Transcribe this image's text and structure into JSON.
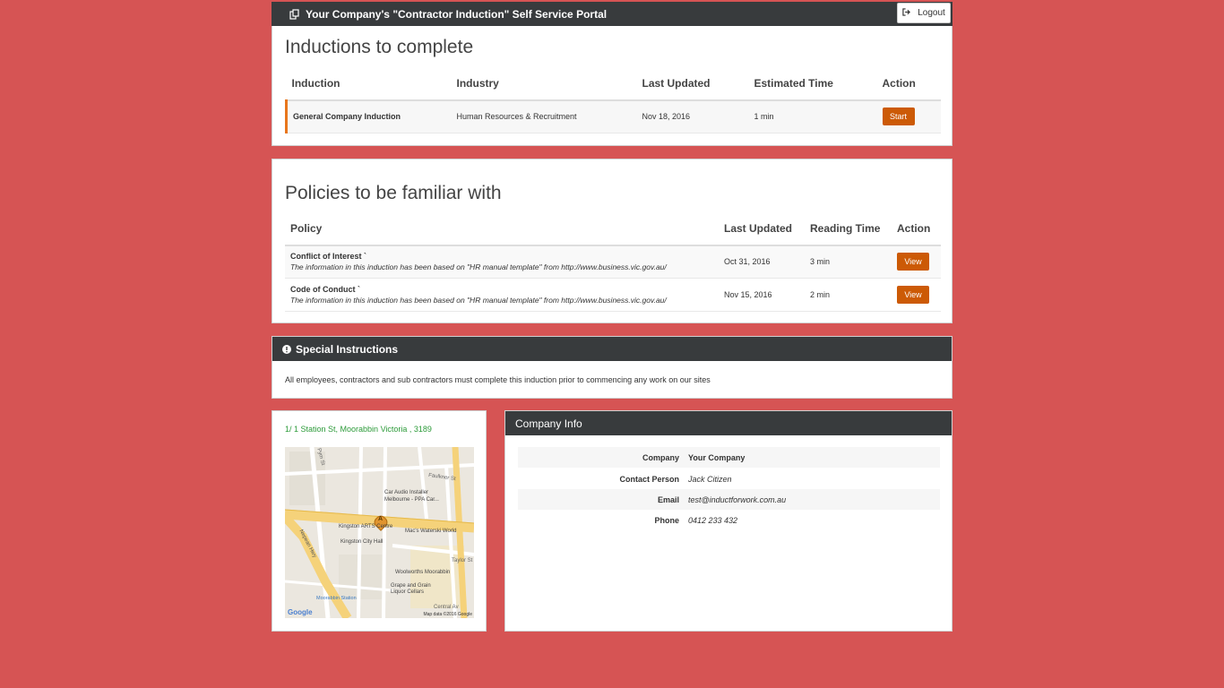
{
  "header": {
    "title": "Your Company's \"Contractor Induction\" Self Service Portal",
    "logout_label": "Logout"
  },
  "inductions": {
    "title": "Inductions to complete",
    "columns": [
      "Induction",
      "Industry",
      "Last Updated",
      "Estimated Time",
      "Action"
    ],
    "rows": [
      {
        "induction": "General Company Induction",
        "industry": "Human Resources & Recruitment",
        "last_updated": "Nov 18, 2016",
        "estimated_time": "1 min",
        "action": "Start"
      }
    ]
  },
  "policies": {
    "title": "Policies to be familiar with",
    "columns": [
      "Policy",
      "Last Updated",
      "Reading Time",
      "Action"
    ],
    "rows": [
      {
        "policy": "Conflict of Interest `",
        "note": "The information in this induction has been based on \"HR manual template\" from http://www.business.vic.gov.au/",
        "last_updated": "Oct 31, 2016",
        "reading_time": "3 min",
        "action": "View"
      },
      {
        "policy": "Code of Conduct `",
        "note": "The information in this induction has been based on \"HR manual template\" from http://www.business.vic.gov.au/",
        "last_updated": "Nov 15, 2016",
        "reading_time": "2 min",
        "action": "View"
      }
    ]
  },
  "special": {
    "title": "Special Instructions",
    "text": "All employees, contractors and sub contractors must complete this induction prior to commencing any work on our sites"
  },
  "location": {
    "address": "1/ 1 Station St, Moorabbin Victoria , 3189",
    "map_labels": {
      "car_audio": "Car Audio Installer",
      "car_audio_2": "Melbourne - PPA Car...",
      "kingston_arts": "Kingston ARTS Centre",
      "kingston_hall": "Kingston City Hall",
      "macs": "Mac's Waterski World",
      "woolworths": "Woolworths Moorabbin",
      "grape": "Grape and Grain",
      "grape_2": "Liquor Cellars",
      "station": "Moorabbin Station",
      "nepean": "Nepean Hwy",
      "faulkner": "Faulkner St",
      "taylor": "Taylor St",
      "central": "Central Av",
      "pym": "Pym St",
      "google": "Google",
      "map_data": "Map data ©2016 Google",
      "marker": "A"
    }
  },
  "company": {
    "title": "Company Info",
    "rows": [
      {
        "label": "Company",
        "value": "Your Company"
      },
      {
        "label": "Contact Person",
        "value": "Jack Citizen"
      },
      {
        "label": "Email",
        "value": "test@inductforwork.com.au"
      },
      {
        "label": "Phone",
        "value": "0412 233 432"
      }
    ]
  },
  "colors": {
    "background": "#d65454",
    "header_bar": "#383b3d",
    "action_button": "#cc5a06",
    "row_accent": "#e8761c",
    "address_link": "#2d9b3a"
  },
  "icons": {
    "header": "copy-icon",
    "logout": "sign-out-icon",
    "special": "exclamation-circle-icon"
  }
}
